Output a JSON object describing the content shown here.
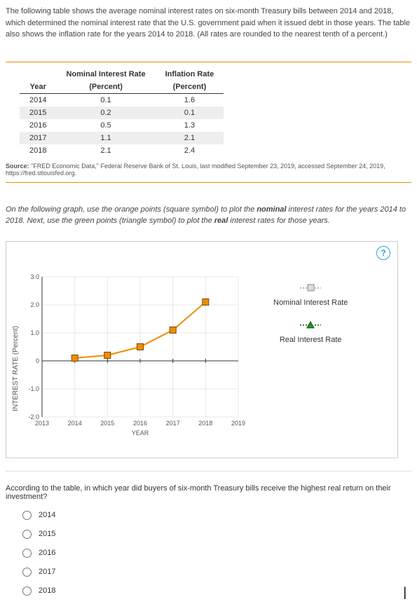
{
  "intro": "The following table shows the average nominal interest rates on six-month Treasury bills between 2014 and 2018, which determined the nominal interest rate that the U.S. government paid when it issued debt in those years. The table also shows the inflation rate for the years 2014 to 2018. (All rates are rounded to the nearest tenth of a percent.)",
  "table": {
    "headers": {
      "year": "Year",
      "nir_top": "Nominal Interest Rate",
      "nir_sub": "(Percent)",
      "inf_top": "Inflation Rate",
      "inf_sub": "(Percent)"
    },
    "rows": [
      {
        "year": "2014",
        "nir": "0.1",
        "inf": "1.6"
      },
      {
        "year": "2015",
        "nir": "0.2",
        "inf": "0.1"
      },
      {
        "year": "2016",
        "nir": "0.5",
        "inf": "1.3"
      },
      {
        "year": "2017",
        "nir": "1.1",
        "inf": "2.1"
      },
      {
        "year": "2018",
        "nir": "2.1",
        "inf": "2.4"
      }
    ]
  },
  "source_label": "Source:",
  "source_text": "\"FRED Economic Data,\" Federal Reserve Bank of St. Louis, last modified September 23, 2019, accessed September 24, 2019, https://fred.stlouisfed.org.",
  "instructions_pre": "On the following graph, use the orange points (square symbol) to plot the ",
  "instructions_b1": "nominal",
  "instructions_mid": " interest rates for the years 2014 to 2018. Next, use the green points (triangle symbol) to plot the ",
  "instructions_b2": "real",
  "instructions_post": " interest rates for those years.",
  "help_symbol": "?",
  "chart": {
    "y_label": "INTEREST RATE (Percent)",
    "x_label": "YEAR",
    "y_ticks": [
      "3.0",
      "2.0",
      "1.0",
      "0",
      "-1.0",
      "-2.0"
    ],
    "x_ticks": [
      "2013",
      "2014",
      "2015",
      "2016",
      "2017",
      "2018",
      "2019"
    ]
  },
  "chart_data": {
    "type": "line",
    "xlabel": "YEAR",
    "ylabel": "INTEREST RATE (Percent)",
    "ylim": [
      -2.0,
      3.0
    ],
    "xlim": [
      2013,
      2019
    ],
    "series": [
      {
        "name": "Nominal Interest Rate",
        "symbol": "square",
        "color": "#f08c00",
        "x": [
          2014,
          2015,
          2016,
          2017,
          2018
        ],
        "y": [
          0.1,
          0.2,
          0.5,
          1.1,
          2.1
        ]
      }
    ]
  },
  "legend": {
    "nominal": "Nominal Interest Rate",
    "real": "Real Interest Rate"
  },
  "question": "According to the table, in which year did buyers of six-month Treasury bills receive the highest real return on their investment?",
  "options": [
    "2014",
    "2015",
    "2016",
    "2017",
    "2018"
  ]
}
